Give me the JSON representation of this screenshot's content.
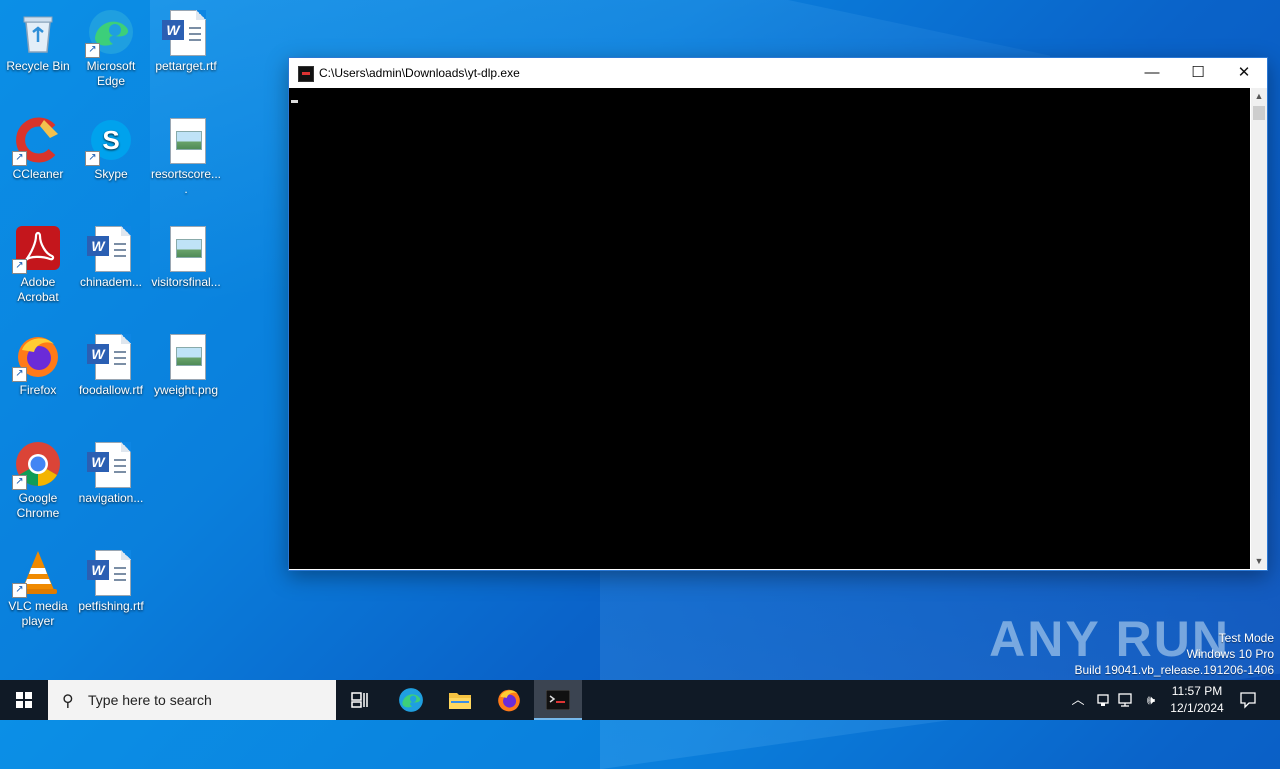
{
  "desktop": {
    "icons": [
      {
        "label": "Recycle Bin"
      },
      {
        "label": "Microsoft Edge"
      },
      {
        "label": "pettarget.rtf"
      },
      {
        "label": "CCleaner"
      },
      {
        "label": "Skype"
      },
      {
        "label": "resortscore...."
      },
      {
        "label": "Adobe Acrobat"
      },
      {
        "label": "chinadem..."
      },
      {
        "label": "visitorsfinal..."
      },
      {
        "label": "Firefox"
      },
      {
        "label": "foodallow.rtf"
      },
      {
        "label": "yweight.png"
      },
      {
        "label": "Google Chrome"
      },
      {
        "label": "navigation..."
      },
      {
        "label": "VLC media player"
      },
      {
        "label": "petfishing.rtf"
      }
    ]
  },
  "console_window": {
    "title": "C:\\Users\\admin\\Downloads\\yt-dlp.exe",
    "minimize_glyph": "—",
    "maximize_glyph": "☐",
    "close_glyph": "✕"
  },
  "watermark": {
    "text": "ANY RUN"
  },
  "system_info": {
    "line1": "Test Mode",
    "line2": "Windows 10 Pro",
    "line3": "Build 19041.vb_release.191206-1406"
  },
  "taskbar": {
    "search_placeholder": "Type here to search",
    "time": "11:57 PM",
    "date": "12/1/2024"
  },
  "colors": {
    "taskbar_bg": "#101a26",
    "accent": "#76b9ed",
    "desktop_bg": "#0a7fdc"
  }
}
